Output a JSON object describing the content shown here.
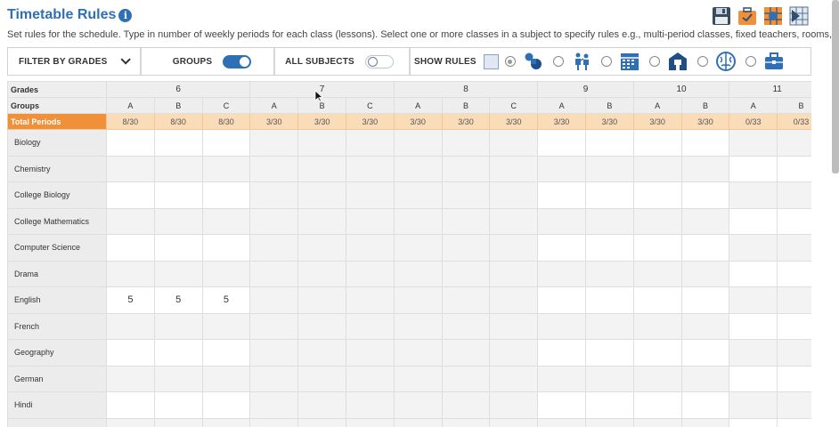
{
  "header": {
    "title": "Timetable Rules",
    "info_glyph": "i",
    "subtitle": "Set rules for the schedule. Type in number of weekly periods for each class (lessons). Select one or more classes in a subject to specify rules e.g., multi-period classes, fixed teachers, rooms, etc.",
    "icons": [
      "save-icon",
      "briefcase-check-icon",
      "grid-dot-icon",
      "schedule-flag-icon"
    ]
  },
  "toolbar": {
    "filter_label": "FILTER BY GRADES",
    "groups_label": "GROUPS",
    "groups_on": true,
    "all_subjects_label": "ALL SUBJECTS",
    "all_subjects_on": false,
    "show_rules_label": "SHOW RULES",
    "rule_options": [
      "classes-icon",
      "teachers-icon",
      "calendar-icon",
      "room-icon",
      "brain-icon",
      "briefcase-icon"
    ]
  },
  "grid": {
    "grades_label": "Grades",
    "groups_label": "Groups",
    "total_label": "Total Periods",
    "grades": [
      {
        "name": "6",
        "groups": [
          "A",
          "B",
          "C"
        ],
        "totals": [
          "8/30",
          "8/30",
          "8/30"
        ]
      },
      {
        "name": "7",
        "groups": [
          "A",
          "B",
          "C"
        ],
        "totals": [
          "3/30",
          "3/30",
          "3/30"
        ]
      },
      {
        "name": "8",
        "groups": [
          "A",
          "B",
          "C"
        ],
        "totals": [
          "3/30",
          "3/30",
          "3/30"
        ]
      },
      {
        "name": "9",
        "groups": [
          "A",
          "B"
        ],
        "totals": [
          "3/30",
          "3/30"
        ]
      },
      {
        "name": "10",
        "groups": [
          "A",
          "B"
        ],
        "totals": [
          "3/30",
          "3/30"
        ]
      },
      {
        "name": "11",
        "groups": [
          "A",
          "B"
        ],
        "totals": [
          "0/33",
          "0/33"
        ]
      }
    ],
    "subjects": [
      {
        "name": "Biology",
        "values": [
          "",
          "",
          "",
          "",
          "",
          "",
          "",
          "",
          "",
          "",
          "",
          "",
          "",
          "",
          ""
        ]
      },
      {
        "name": "Chemistry",
        "values": [
          "",
          "",
          "",
          "",
          "",
          "",
          "",
          "",
          "",
          "",
          "",
          "",
          "",
          "",
          ""
        ]
      },
      {
        "name": "College Biology",
        "values": [
          "",
          "",
          "",
          "",
          "",
          "",
          "",
          "",
          "",
          "",
          "",
          "",
          "",
          "",
          ""
        ]
      },
      {
        "name": "College Mathematics",
        "values": [
          "",
          "",
          "",
          "",
          "",
          "",
          "",
          "",
          "",
          "",
          "",
          "",
          "",
          "",
          ""
        ]
      },
      {
        "name": "Computer Science",
        "values": [
          "",
          "",
          "",
          "",
          "",
          "",
          "",
          "",
          "",
          "",
          "",
          "",
          "",
          "",
          ""
        ]
      },
      {
        "name": "Drama",
        "values": [
          "",
          "",
          "",
          "",
          "",
          "",
          "",
          "",
          "",
          "",
          "",
          "",
          "",
          "",
          ""
        ]
      },
      {
        "name": "English",
        "values": [
          "5",
          "5",
          "5",
          "",
          "",
          "",
          "",
          "",
          "",
          "",
          "",
          "",
          "",
          "",
          ""
        ]
      },
      {
        "name": "French",
        "values": [
          "",
          "",
          "",
          "",
          "",
          "",
          "",
          "",
          "",
          "",
          "",
          "",
          "",
          "",
          ""
        ]
      },
      {
        "name": "Geography",
        "values": [
          "",
          "",
          "",
          "",
          "",
          "",
          "",
          "",
          "",
          "",
          "",
          "",
          "",
          "",
          ""
        ]
      },
      {
        "name": "German",
        "values": [
          "",
          "",
          "",
          "",
          "",
          "",
          "",
          "",
          "",
          "",
          "",
          "",
          "",
          "",
          ""
        ]
      },
      {
        "name": "Hindi",
        "values": [
          "",
          "",
          "",
          "",
          "",
          "",
          "",
          "",
          "",
          "",
          "",
          "",
          "",
          "",
          ""
        ]
      },
      {
        "name": "",
        "values": [
          "",
          "",
          "",
          "",
          "",
          "",
          "",
          "",
          "",
          "",
          "",
          "",
          "",
          "",
          ""
        ]
      }
    ]
  },
  "colors": {
    "accent": "#2f6fb5",
    "total_row": "#f0913a",
    "total_cells": "#fbdcb8"
  }
}
